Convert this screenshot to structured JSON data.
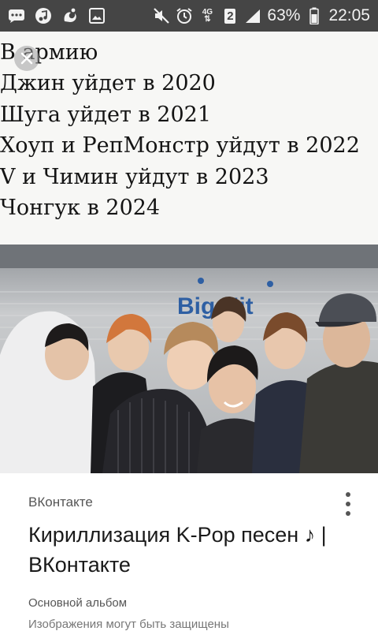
{
  "status_bar": {
    "icons_left": [
      "messages-icon",
      "music-icon",
      "uc-browser-icon",
      "gallery-icon"
    ],
    "icons_right": [
      "mute-icon",
      "alarm-icon",
      "network-4g-icon",
      "sim-2-icon",
      "signal-icon"
    ],
    "network_label": "4G",
    "sim_label": "2",
    "battery": "63%",
    "time": "22:05"
  },
  "meme": {
    "lines": [
      "В армию",
      "Джин уйдет в 2020",
      "Шуга уйдет в 2021",
      "Хоуп и РепМонстр уйдут в 2022",
      "V и Чимин уйдут в 2023",
      "Чонгук в 2024"
    ],
    "photo_sign": "Big Hit"
  },
  "card": {
    "source": "ВКонтакте",
    "title": "Кириллизация K-Pop песен ♪ | ВКонтакте",
    "album": "Основной альбом",
    "copyright_note": "Изображения могут быть защищены"
  },
  "colors": {
    "status_bar_bg": "#454545",
    "meme_bg": "#f7f7f5",
    "card_text": "#1a1a1a",
    "secondary_text": "#555555"
  }
}
